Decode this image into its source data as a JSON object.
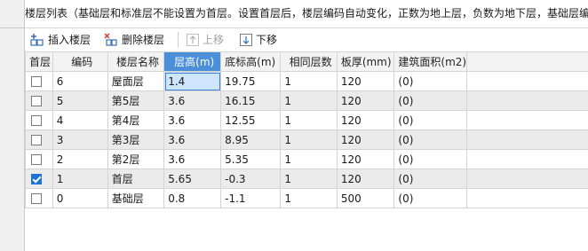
{
  "description": "楼层列表（基础层和标准层不能设置为首层。设置首层后，楼层编码自动变化，正数为地上层，负数为地下层，基础层编",
  "toolbar": {
    "insert_label": "插入楼层",
    "delete_label": "删除楼层",
    "move_up_label": "上移",
    "move_down_label": "下移"
  },
  "table": {
    "columns": [
      "首层",
      "编码",
      "楼层名称",
      "层高(m)",
      "底标高(m)",
      "相同层数",
      "板厚(mm)",
      "建筑面积(m2)"
    ],
    "rows": [
      {
        "first": false,
        "code": "6",
        "name": "屋面层",
        "height": "1.4",
        "elevation": "19.75",
        "same": "1",
        "thickness": "120",
        "area": "(0)"
      },
      {
        "first": false,
        "code": "5",
        "name": "第5层",
        "height": "3.6",
        "elevation": "16.15",
        "same": "1",
        "thickness": "120",
        "area": "(0)"
      },
      {
        "first": false,
        "code": "4",
        "name": "第4层",
        "height": "3.6",
        "elevation": "12.55",
        "same": "1",
        "thickness": "120",
        "area": "(0)"
      },
      {
        "first": false,
        "code": "3",
        "name": "第3层",
        "height": "3.6",
        "elevation": "8.95",
        "same": "1",
        "thickness": "120",
        "area": "(0)"
      },
      {
        "first": false,
        "code": "2",
        "name": "第2层",
        "height": "3.6",
        "elevation": "5.35",
        "same": "1",
        "thickness": "120",
        "area": "(0)"
      },
      {
        "first": true,
        "code": "1",
        "name": "首层",
        "height": "5.65",
        "elevation": "-0.3",
        "same": "1",
        "thickness": "120",
        "area": "(0)"
      },
      {
        "first": false,
        "code": "0",
        "name": "基础层",
        "height": "0.8",
        "elevation": "-1.1",
        "same": "1",
        "thickness": "500",
        "area": "(0)"
      }
    ]
  },
  "colors": {
    "selected_header": "#4a8fd8",
    "selected_cell": "#cfe5fb",
    "checkbox_checked": "#1e74d6",
    "alt_row": "#ebebeb"
  }
}
